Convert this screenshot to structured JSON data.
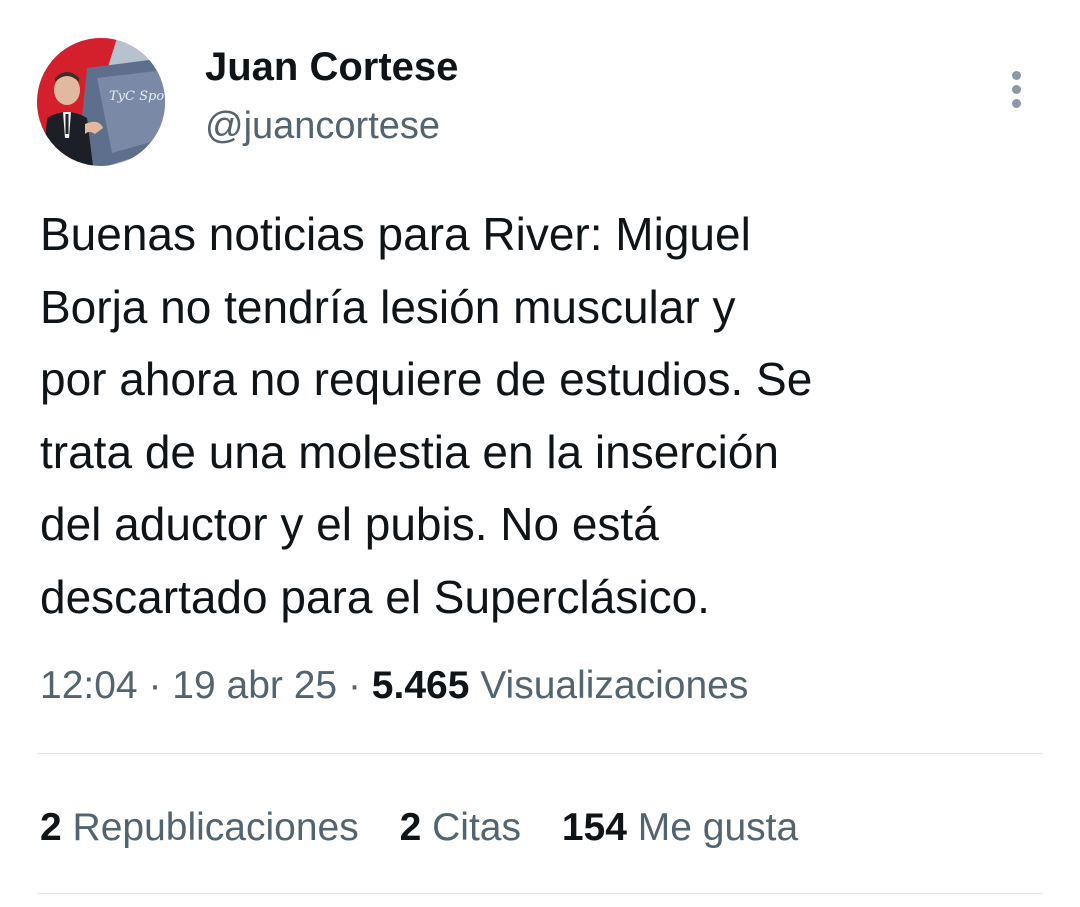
{
  "user": {
    "display_name": "Juan Cortese",
    "handle": "@juancortese",
    "avatar_logo": "TyC Sports"
  },
  "more_icon": "more-vertical-icon",
  "tweet": {
    "lines": [
      "Buenas noticias para River: Miguel",
      "Borja no tendría lesión muscular y",
      "por ahora no requiere de estudios. Se",
      "trata de una molestia en la inserción",
      "del aductor y el pubis. No está",
      "descartado para el Superclásico."
    ]
  },
  "meta": {
    "time": "12:04",
    "separator": "·",
    "date": "19 abr 25",
    "views_count": "5.465",
    "views_label": "Visualizaciones"
  },
  "stats": {
    "reposts_count": "2",
    "reposts_label": "Republicaciones",
    "quotes_count": "2",
    "quotes_label": "Citas",
    "likes_count": "154",
    "likes_label": "Me gusta"
  },
  "colors": {
    "primary_text": "#0f1419",
    "secondary_text": "#536471",
    "divider": "#e1e6ea"
  }
}
